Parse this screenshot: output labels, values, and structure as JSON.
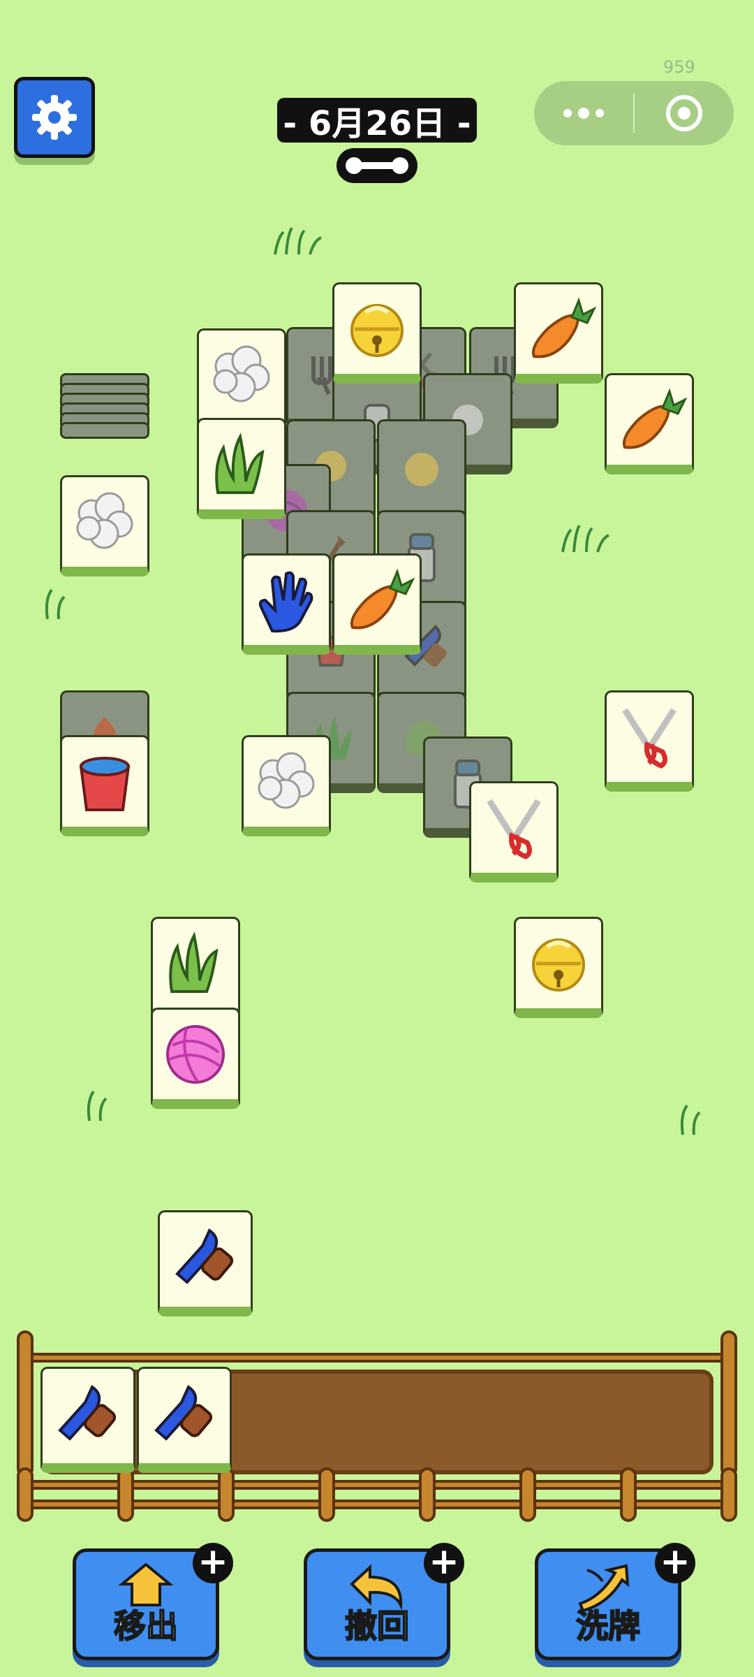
{
  "header": {
    "date_label": "- 6月26日 -",
    "counter": "959"
  },
  "icons": {
    "settings": "gear-icon",
    "menu": "more-dots-icon",
    "close": "target-circle-icon",
    "progress": "dog-bone-icon"
  },
  "board": {
    "tiles": [
      "bell",
      "carrot",
      "carrot",
      "fluff",
      "fluff",
      "grass",
      "glove",
      "carrot",
      "bucket",
      "fluff",
      "shears",
      "shears",
      "bell",
      "grass",
      "yarn",
      "brush"
    ],
    "tray_slots": [
      "brush",
      "brush"
    ],
    "tray_capacity": 7
  },
  "actions": [
    {
      "label": "移出",
      "icon": "move-out-arrow-icon"
    },
    {
      "label": "撤回",
      "icon": "undo-arrow-icon"
    },
    {
      "label": "洗牌",
      "icon": "shuffle-arrows-icon"
    }
  ],
  "colors": {
    "background": "#c9f59a",
    "tile_face": "#fcfde3",
    "tile_edge": "#7fb74a",
    "button": "#3f8ef0",
    "tray_wood": "#8b5a2b"
  }
}
